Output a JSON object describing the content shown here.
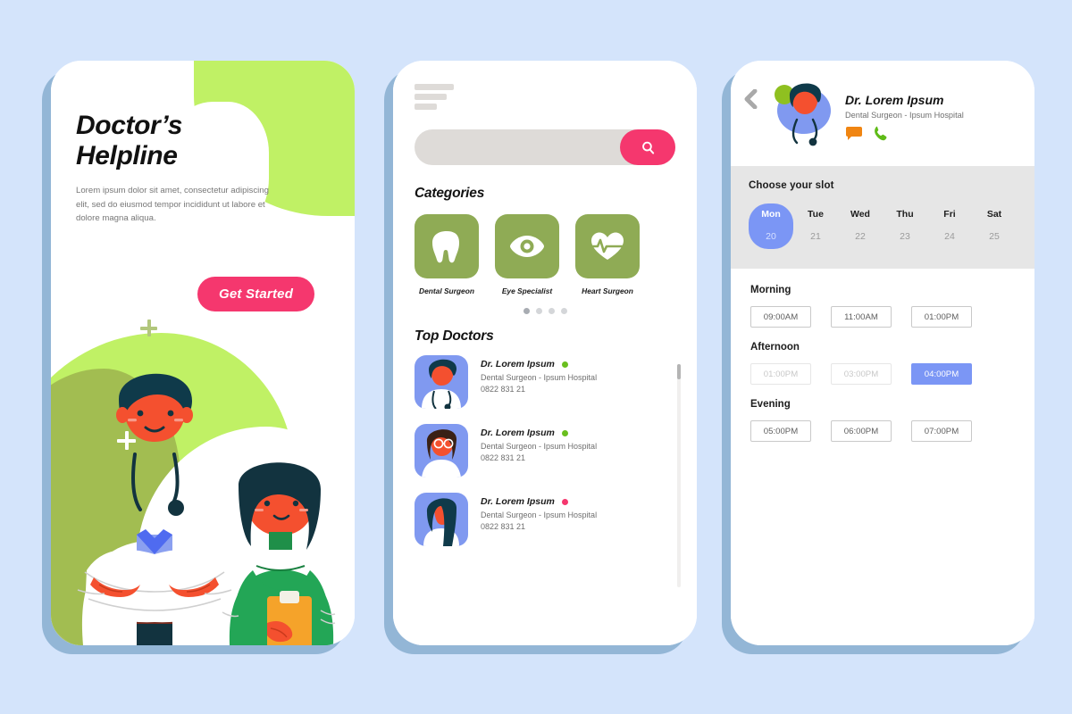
{
  "theme": {
    "page_background": "#d4e4fb",
    "phone_shadow": "#93b6d6",
    "accent_pink": "#f5376e",
    "accent_lime": "#c0f165",
    "accent_olive": "#8fab55",
    "accent_periwinkle": "#7b96f5",
    "avatar_blue": "#8099f0",
    "status_online": "#6abf1f",
    "status_busy": "#f5376e",
    "panel_gray": "#e6e6e6",
    "field_gray": "#dedbd8"
  },
  "screen1": {
    "title_line1": "Doctor’s",
    "title_line2": "Helpline",
    "subtitle": "Lorem ipsum dolor sit amet, consectetur adipiscing elit, sed do eiusmod tempor incididunt ut labore et dolore magna aliqua.",
    "cta_label": "Get Started"
  },
  "screen2": {
    "search": {
      "value": "",
      "placeholder": ""
    },
    "categories_title": "Categories",
    "categories": [
      {
        "label": "Dental Surgeon",
        "icon": "tooth-icon"
      },
      {
        "label": "Eye Specialist",
        "icon": "eye-icon"
      },
      {
        "label": "Heart Surgeon",
        "icon": "heart-pulse-icon"
      }
    ],
    "carousel_dots": 4,
    "carousel_active_index": 0,
    "top_doctors_title": "Top Doctors",
    "doctors": [
      {
        "name": "Dr. Lorem Ipsum",
        "specialty": "Dental Surgeon - Ipsum Hospital",
        "phone": "0822 831 21",
        "status_color": "#6abf1f",
        "avatar": "doctor-male-stethoscope"
      },
      {
        "name": "Dr. Lorem Ipsum",
        "specialty": "Dental Surgeon - Ipsum Hospital",
        "phone": "0822 831 21",
        "status_color": "#6abf1f",
        "avatar": "doctor-female-glasses"
      },
      {
        "name": "Dr. Lorem Ipsum",
        "specialty": "Dental Surgeon - Ipsum Hospital",
        "phone": "0822 831 21",
        "status_color": "#f5376e",
        "avatar": "doctor-female-longhair"
      }
    ]
  },
  "screen3": {
    "doctor": {
      "name": "Dr. Lorem Ipsum",
      "specialty": "Dental Surgeon - Ipsum Hospital"
    },
    "slot_panel_title": "Choose your slot",
    "days": [
      {
        "name": "Mon",
        "num": "20",
        "selected": true
      },
      {
        "name": "Tue",
        "num": "21",
        "selected": false
      },
      {
        "name": "Wed",
        "num": "22",
        "selected": false
      },
      {
        "name": "Thu",
        "num": "23",
        "selected": false
      },
      {
        "name": "Fri",
        "num": "24",
        "selected": false
      },
      {
        "name": "Sat",
        "num": "25",
        "selected": false
      }
    ],
    "slot_groups": [
      {
        "title": "Morning",
        "slots": [
          {
            "time": "09:00AM",
            "state": "available"
          },
          {
            "time": "11:00AM",
            "state": "available"
          },
          {
            "time": "01:00PM",
            "state": "available"
          }
        ]
      },
      {
        "title": "Afternoon",
        "slots": [
          {
            "time": "01:00PM",
            "state": "disabled"
          },
          {
            "time": "03:00PM",
            "state": "disabled"
          },
          {
            "time": "04:00PM",
            "state": "selected"
          }
        ]
      },
      {
        "title": "Evening",
        "slots": [
          {
            "time": "05:00PM",
            "state": "available"
          },
          {
            "time": "06:00PM",
            "state": "available"
          },
          {
            "time": "07:00PM",
            "state": "available"
          }
        ]
      }
    ]
  }
}
